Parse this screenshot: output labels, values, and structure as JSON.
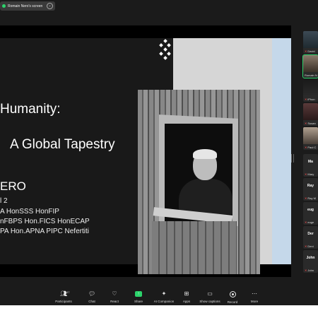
{
  "top": {
    "share_label": "Romain Nero's screen",
    "chevron": "⌄"
  },
  "slide": {
    "title_line1": "Humanity:",
    "title_line2": "A Global Tapestry",
    "name": "ERO",
    "credentials": [
      "l 2",
      "A HonSSS HonFIP",
      "nFBPS Hon.FICS HonECAP",
      "PA Hon.APNA PIPC Nefertiti"
    ]
  },
  "participants": [
    {
      "label": "David",
      "big": ""
    },
    {
      "label": "Romain N",
      "big": ""
    },
    {
      "label": "iPhon",
      "big": ""
    },
    {
      "label": "Susan",
      "big": ""
    },
    {
      "label": "Paul C",
      "big": ""
    },
    {
      "label": "Mary",
      "big": "Ma"
    },
    {
      "label": "Ray M",
      "big": "Ray"
    },
    {
      "label": "euge",
      "big": "eug"
    },
    {
      "label": "Deni",
      "big": "Der"
    },
    {
      "label": "John",
      "big": "John"
    }
  ],
  "toolbar": {
    "participants_label": "Participants",
    "participants_count": "47",
    "chat_label": "Chat",
    "react_label": "React",
    "share_label": "Share",
    "ai_label": "AI Companion",
    "apps_label": "Apps",
    "captions_label": "Show captions",
    "record_label": "Record",
    "more_label": "More"
  },
  "colors": {
    "accent_green": "#2bd36b",
    "mute_red": "#ff4d4d",
    "slide_dark": "#191919",
    "slide_light": "#d6d6d6",
    "slide_blue": "#c5d8ea"
  }
}
